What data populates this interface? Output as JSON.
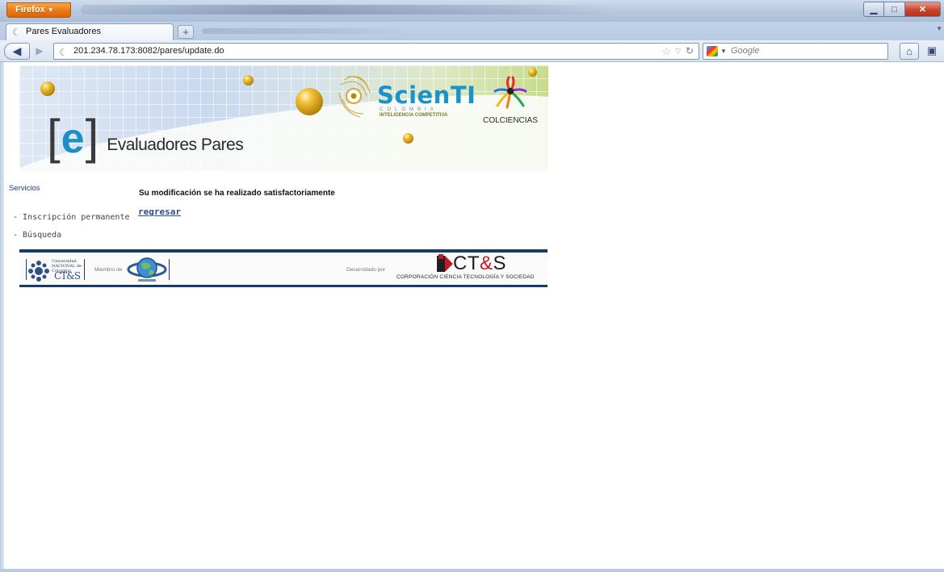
{
  "browser": {
    "app_button": "Firefox",
    "tab_title": "Pares Evaluadores",
    "url": "201.234.78.173:8082/pares/update.do",
    "search_placeholder": "Google"
  },
  "banner": {
    "scienti_name": "ScienTI",
    "scienti_country": "COLOMBIA",
    "scienti_tagline": "INTELIGENCIA COMPETITIVA",
    "colciencias": "COLCIENCIAS",
    "e_letter": "e",
    "bracket_open": "[",
    "bracket_close": "]",
    "title": "Evaluadores Pares"
  },
  "sidebar": {
    "title": "Servicios",
    "items": [
      {
        "label": "- Inscripción permanente"
      },
      {
        "label": "- Búsqueda"
      }
    ]
  },
  "main": {
    "message": "Su modificación se ha realizado satisfactoriamente",
    "back_link": "regresar"
  },
  "footer": {
    "unal_text": "Universidad NACIONAL de Colombia",
    "unal_cts": "CT&S",
    "miembro": "Miembro de",
    "desarrollado": "Desarrollado por",
    "cts_logo_prefix": "CT",
    "cts_logo_amp": "&",
    "cts_logo_suffix": "S",
    "cts_full": "CORPORACIÓN CIENCIA TECNOLOGÍA Y SOCIEDAD"
  },
  "colors": {
    "firefox_orange": "#ec7c16",
    "scienti_blue": "#1b93c7",
    "footer_navy": "#163d6a",
    "link_blue": "#2c4d8a"
  }
}
